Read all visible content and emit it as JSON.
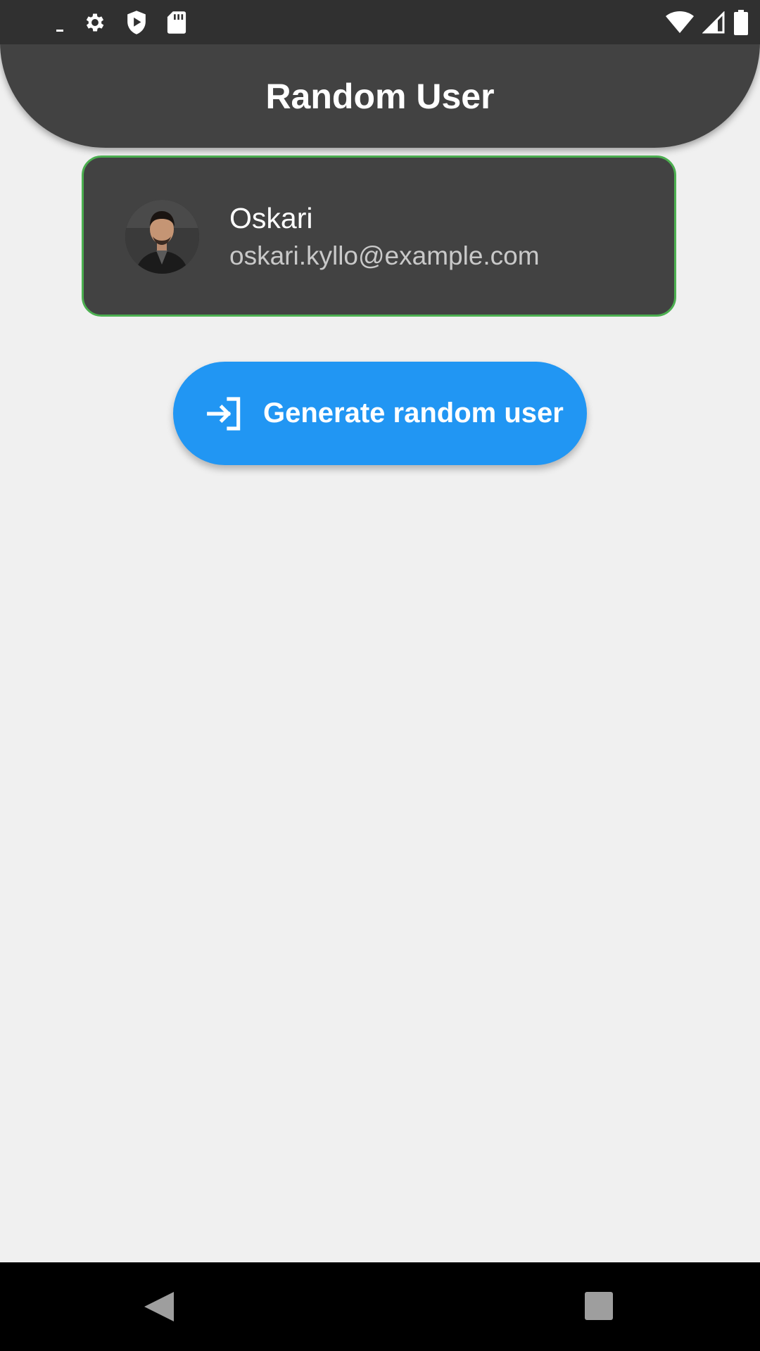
{
  "status_bar": {
    "left_icons": [
      "notification-dash-icon",
      "gear-icon",
      "shield-play-icon",
      "sd-card-icon"
    ],
    "right_icons": [
      "wifi-icon",
      "cell-signal-icon",
      "battery-icon"
    ]
  },
  "app_bar": {
    "title": "Random User",
    "color": "#424242"
  },
  "user_card": {
    "name": "Oskari",
    "email": "oskari.kyllo@example.com",
    "border_color": "#4caf50"
  },
  "generate_button": {
    "label": "Generate random user",
    "icon": "login-icon",
    "color": "#2196f3"
  },
  "nav_bar": {
    "icons": [
      "back-triangle-icon",
      "recents-square-icon"
    ]
  }
}
